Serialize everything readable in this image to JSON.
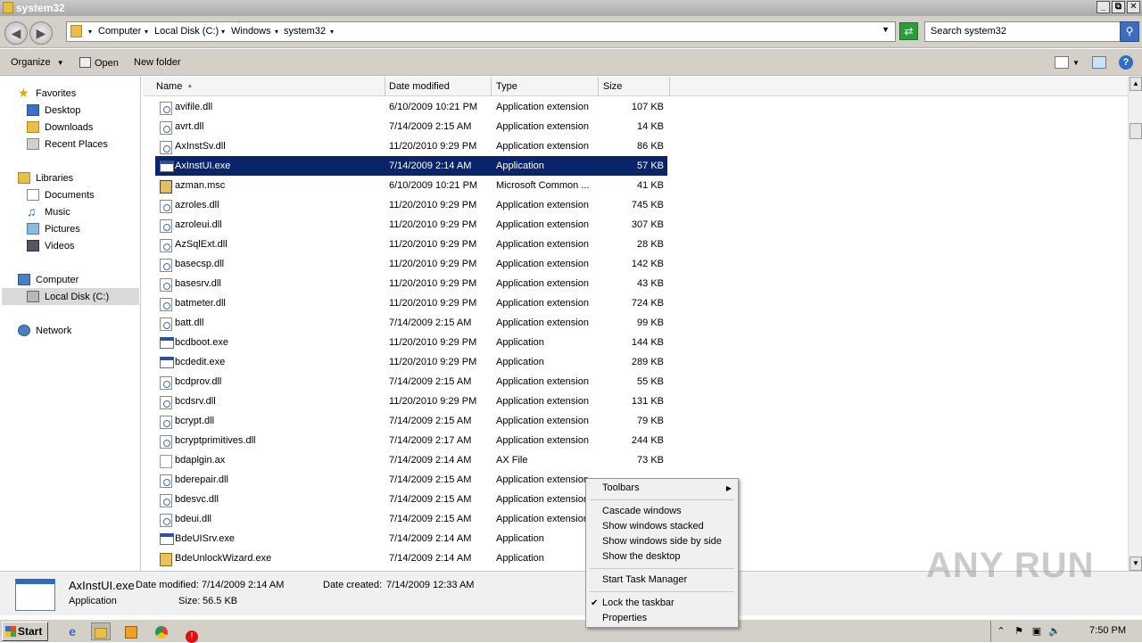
{
  "window": {
    "title": "system32"
  },
  "address": {
    "segments": [
      "Computer",
      "Local Disk (C:)",
      "Windows",
      "system32"
    ]
  },
  "search": {
    "placeholder": "Search system32"
  },
  "toolbar": {
    "organize": "Organize",
    "open": "Open",
    "new_folder": "New folder"
  },
  "nav": {
    "favorites": "Favorites",
    "desktop": "Desktop",
    "downloads": "Downloads",
    "recent_places": "Recent Places",
    "libraries": "Libraries",
    "documents": "Documents",
    "music": "Music",
    "pictures": "Pictures",
    "videos": "Videos",
    "computer": "Computer",
    "local_disk": "Local Disk (C:)",
    "network": "Network"
  },
  "columns": {
    "name": "Name",
    "date": "Date modified",
    "type": "Type",
    "size": "Size"
  },
  "files": [
    {
      "name": "avifile.dll",
      "date": "6/10/2009 10:21 PM",
      "type": "Application extension",
      "size": "107 KB",
      "icon": "dll"
    },
    {
      "name": "avrt.dll",
      "date": "7/14/2009 2:15 AM",
      "type": "Application extension",
      "size": "14 KB",
      "icon": "dll"
    },
    {
      "name": "AxInstSv.dll",
      "date": "11/20/2010 9:29 PM",
      "type": "Application extension",
      "size": "86 KB",
      "icon": "dll"
    },
    {
      "name": "AxInstUI.exe",
      "date": "7/14/2009 2:14 AM",
      "type": "Application",
      "size": "57 KB",
      "icon": "exe",
      "selected": true
    },
    {
      "name": "azman.msc",
      "date": "6/10/2009 10:21 PM",
      "type": "Microsoft Common ...",
      "size": "41 KB",
      "icon": "msc"
    },
    {
      "name": "azroles.dll",
      "date": "11/20/2010 9:29 PM",
      "type": "Application extension",
      "size": "745 KB",
      "icon": "dll"
    },
    {
      "name": "azroleui.dll",
      "date": "11/20/2010 9:29 PM",
      "type": "Application extension",
      "size": "307 KB",
      "icon": "dll"
    },
    {
      "name": "AzSqlExt.dll",
      "date": "11/20/2010 9:29 PM",
      "type": "Application extension",
      "size": "28 KB",
      "icon": "dll"
    },
    {
      "name": "basecsp.dll",
      "date": "11/20/2010 9:29 PM",
      "type": "Application extension",
      "size": "142 KB",
      "icon": "dll"
    },
    {
      "name": "basesrv.dll",
      "date": "11/20/2010 9:29 PM",
      "type": "Application extension",
      "size": "43 KB",
      "icon": "dll"
    },
    {
      "name": "batmeter.dll",
      "date": "11/20/2010 9:29 PM",
      "type": "Application extension",
      "size": "724 KB",
      "icon": "dll"
    },
    {
      "name": "batt.dll",
      "date": "7/14/2009 2:15 AM",
      "type": "Application extension",
      "size": "99 KB",
      "icon": "dll"
    },
    {
      "name": "bcdboot.exe",
      "date": "11/20/2010 9:29 PM",
      "type": "Application",
      "size": "144 KB",
      "icon": "exe"
    },
    {
      "name": "bcdedit.exe",
      "date": "11/20/2010 9:29 PM",
      "type": "Application",
      "size": "289 KB",
      "icon": "exe"
    },
    {
      "name": "bcdprov.dll",
      "date": "7/14/2009 2:15 AM",
      "type": "Application extension",
      "size": "55 KB",
      "icon": "dll"
    },
    {
      "name": "bcdsrv.dll",
      "date": "11/20/2010 9:29 PM",
      "type": "Application extension",
      "size": "131 KB",
      "icon": "dll"
    },
    {
      "name": "bcrypt.dll",
      "date": "7/14/2009 2:15 AM",
      "type": "Application extension",
      "size": "79 KB",
      "icon": "dll"
    },
    {
      "name": "bcryptprimitives.dll",
      "date": "7/14/2009 2:17 AM",
      "type": "Application extension",
      "size": "244 KB",
      "icon": "dll"
    },
    {
      "name": "bdaplgin.ax",
      "date": "7/14/2009 2:14 AM",
      "type": "AX File",
      "size": "73 KB",
      "icon": "file"
    },
    {
      "name": "bderepair.dll",
      "date": "7/14/2009 2:15 AM",
      "type": "Application extension",
      "size": "",
      "icon": "dll"
    },
    {
      "name": "bdesvc.dll",
      "date": "7/14/2009 2:15 AM",
      "type": "Application extension",
      "size": "",
      "icon": "dll"
    },
    {
      "name": "bdeui.dll",
      "date": "7/14/2009 2:15 AM",
      "type": "Application extension",
      "size": "",
      "icon": "dll"
    },
    {
      "name": "BdeUISrv.exe",
      "date": "7/14/2009 2:14 AM",
      "type": "Application",
      "size": "",
      "icon": "exe"
    },
    {
      "name": "BdeUnlockWizard.exe",
      "date": "7/14/2009 2:14 AM",
      "type": "Application",
      "size": "",
      "icon": "wiz"
    }
  ],
  "details": {
    "filename": "AxInstUI.exe",
    "filetype": "Application",
    "date_modified_label": "Date modified:",
    "date_modified": "7/14/2009 2:14 AM",
    "size_label": "Size:",
    "size": "56.5 KB",
    "date_created_label": "Date created:",
    "date_created": "7/14/2009 12:33 AM"
  },
  "context_menu": {
    "toolbars": "Toolbars",
    "cascade": "Cascade windows",
    "stacked": "Show windows stacked",
    "side_by_side": "Show windows side by side",
    "show_desktop": "Show the desktop",
    "task_manager": "Start Task Manager",
    "lock_taskbar": "Lock the taskbar",
    "properties": "Properties"
  },
  "taskbar": {
    "start": "Start",
    "clock": "7:50 PM"
  },
  "watermark": "ANY RUN",
  "colors": {
    "selection": "#0a246a",
    "chrome": "#d4d0c8"
  }
}
